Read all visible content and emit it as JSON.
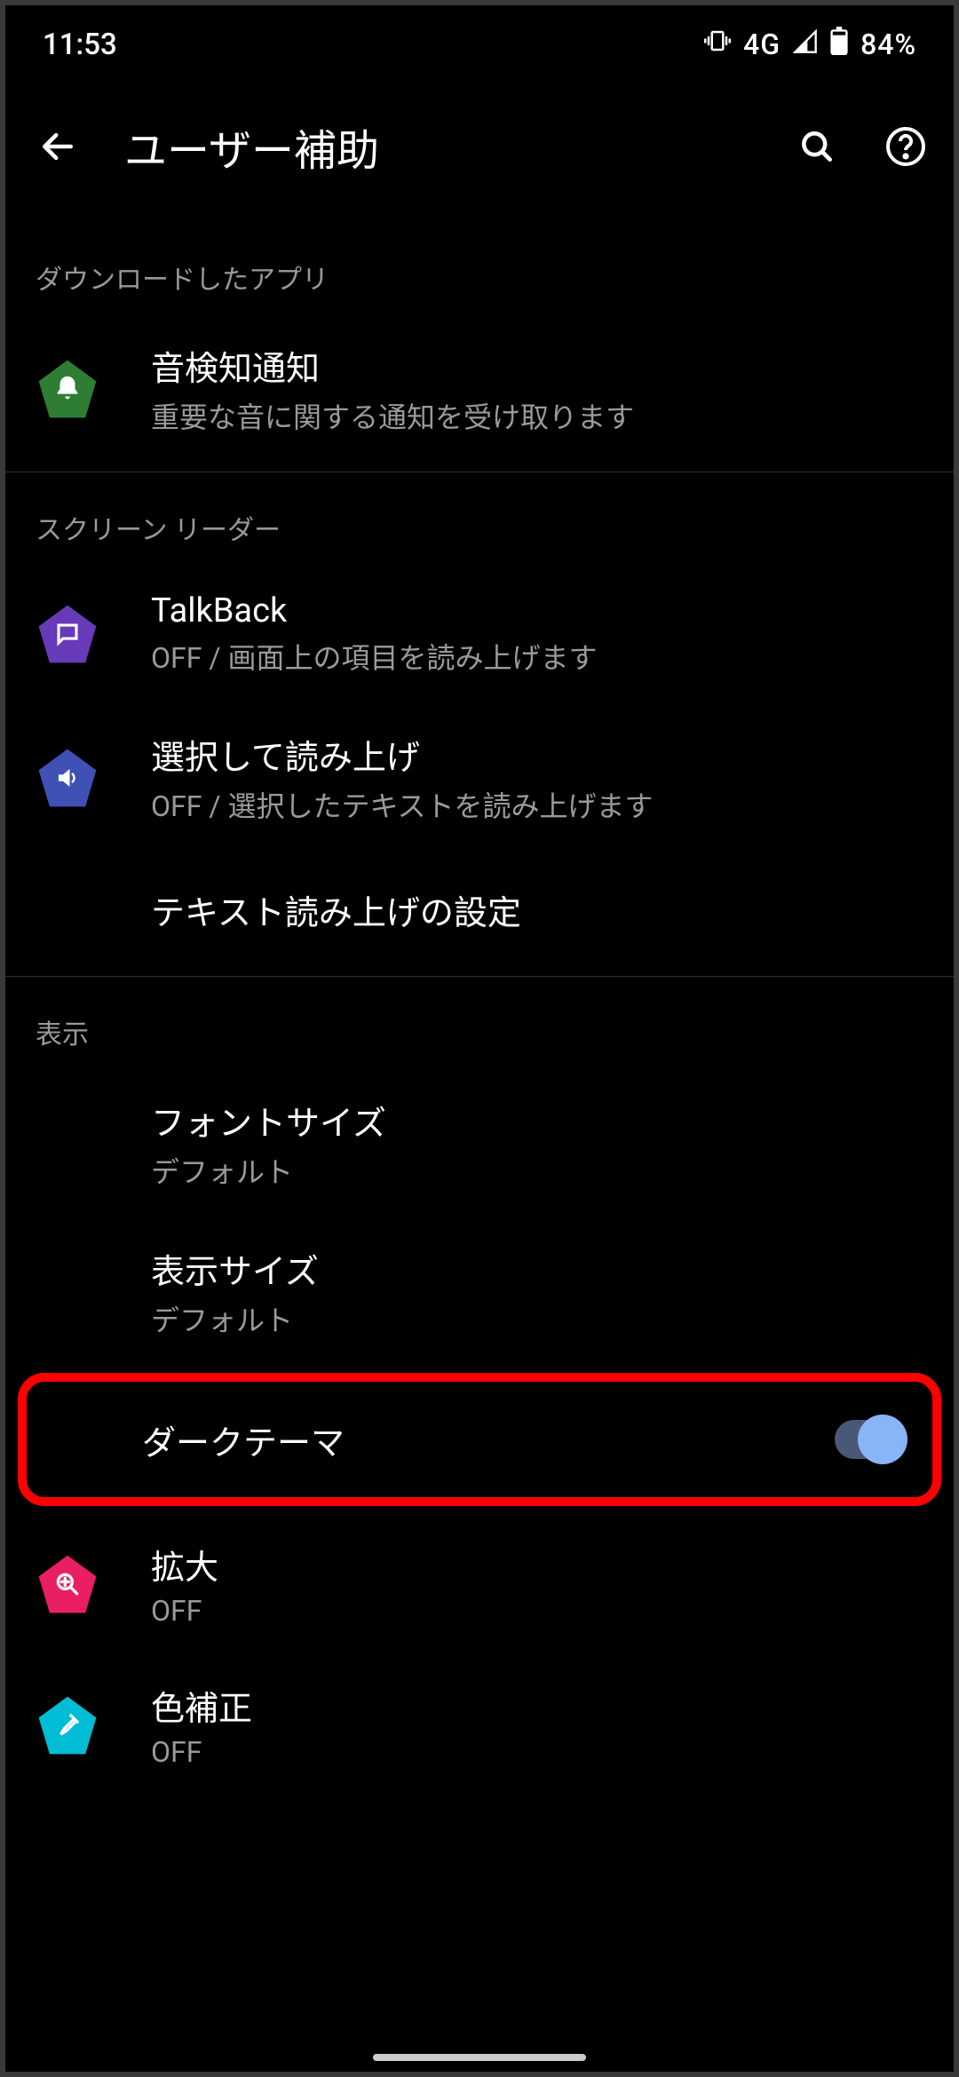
{
  "status": {
    "time": "11:53",
    "network": "4G",
    "battery": "84%"
  },
  "header": {
    "title": "ユーザー補助"
  },
  "sections": {
    "downloaded": {
      "label": "ダウンロードしたアプリ",
      "sound_detection": {
        "title": "音検知通知",
        "sub": "重要な音に関する通知を受け取ります"
      }
    },
    "screen_reader": {
      "label": "スクリーン リーダー",
      "talkback": {
        "title": "TalkBack",
        "sub": "OFF / 画面上の項目を読み上げます"
      },
      "select_speak": {
        "title": "選択して読み上げ",
        "sub": "OFF / 選択したテキストを読み上げます"
      },
      "tts": {
        "title": "テキスト読み上げの設定"
      }
    },
    "display": {
      "label": "表示",
      "font_size": {
        "title": "フォントサイズ",
        "sub": "デフォルト"
      },
      "display_size": {
        "title": "表示サイズ",
        "sub": "デフォルト"
      },
      "dark_theme": {
        "title": "ダークテーマ",
        "state": "on"
      },
      "magnify": {
        "title": "拡大",
        "sub": "OFF"
      },
      "color_correction": {
        "title": "色補正",
        "sub": "OFF"
      }
    }
  },
  "colors": {
    "icon_green": "#2e7d32",
    "icon_purple": "#673ab7",
    "icon_blue": "#3f51b5",
    "icon_magenta": "#e91e63",
    "icon_teal": "#00bcd4",
    "accent": "#8ab4f8",
    "highlight": "#ff0000"
  }
}
